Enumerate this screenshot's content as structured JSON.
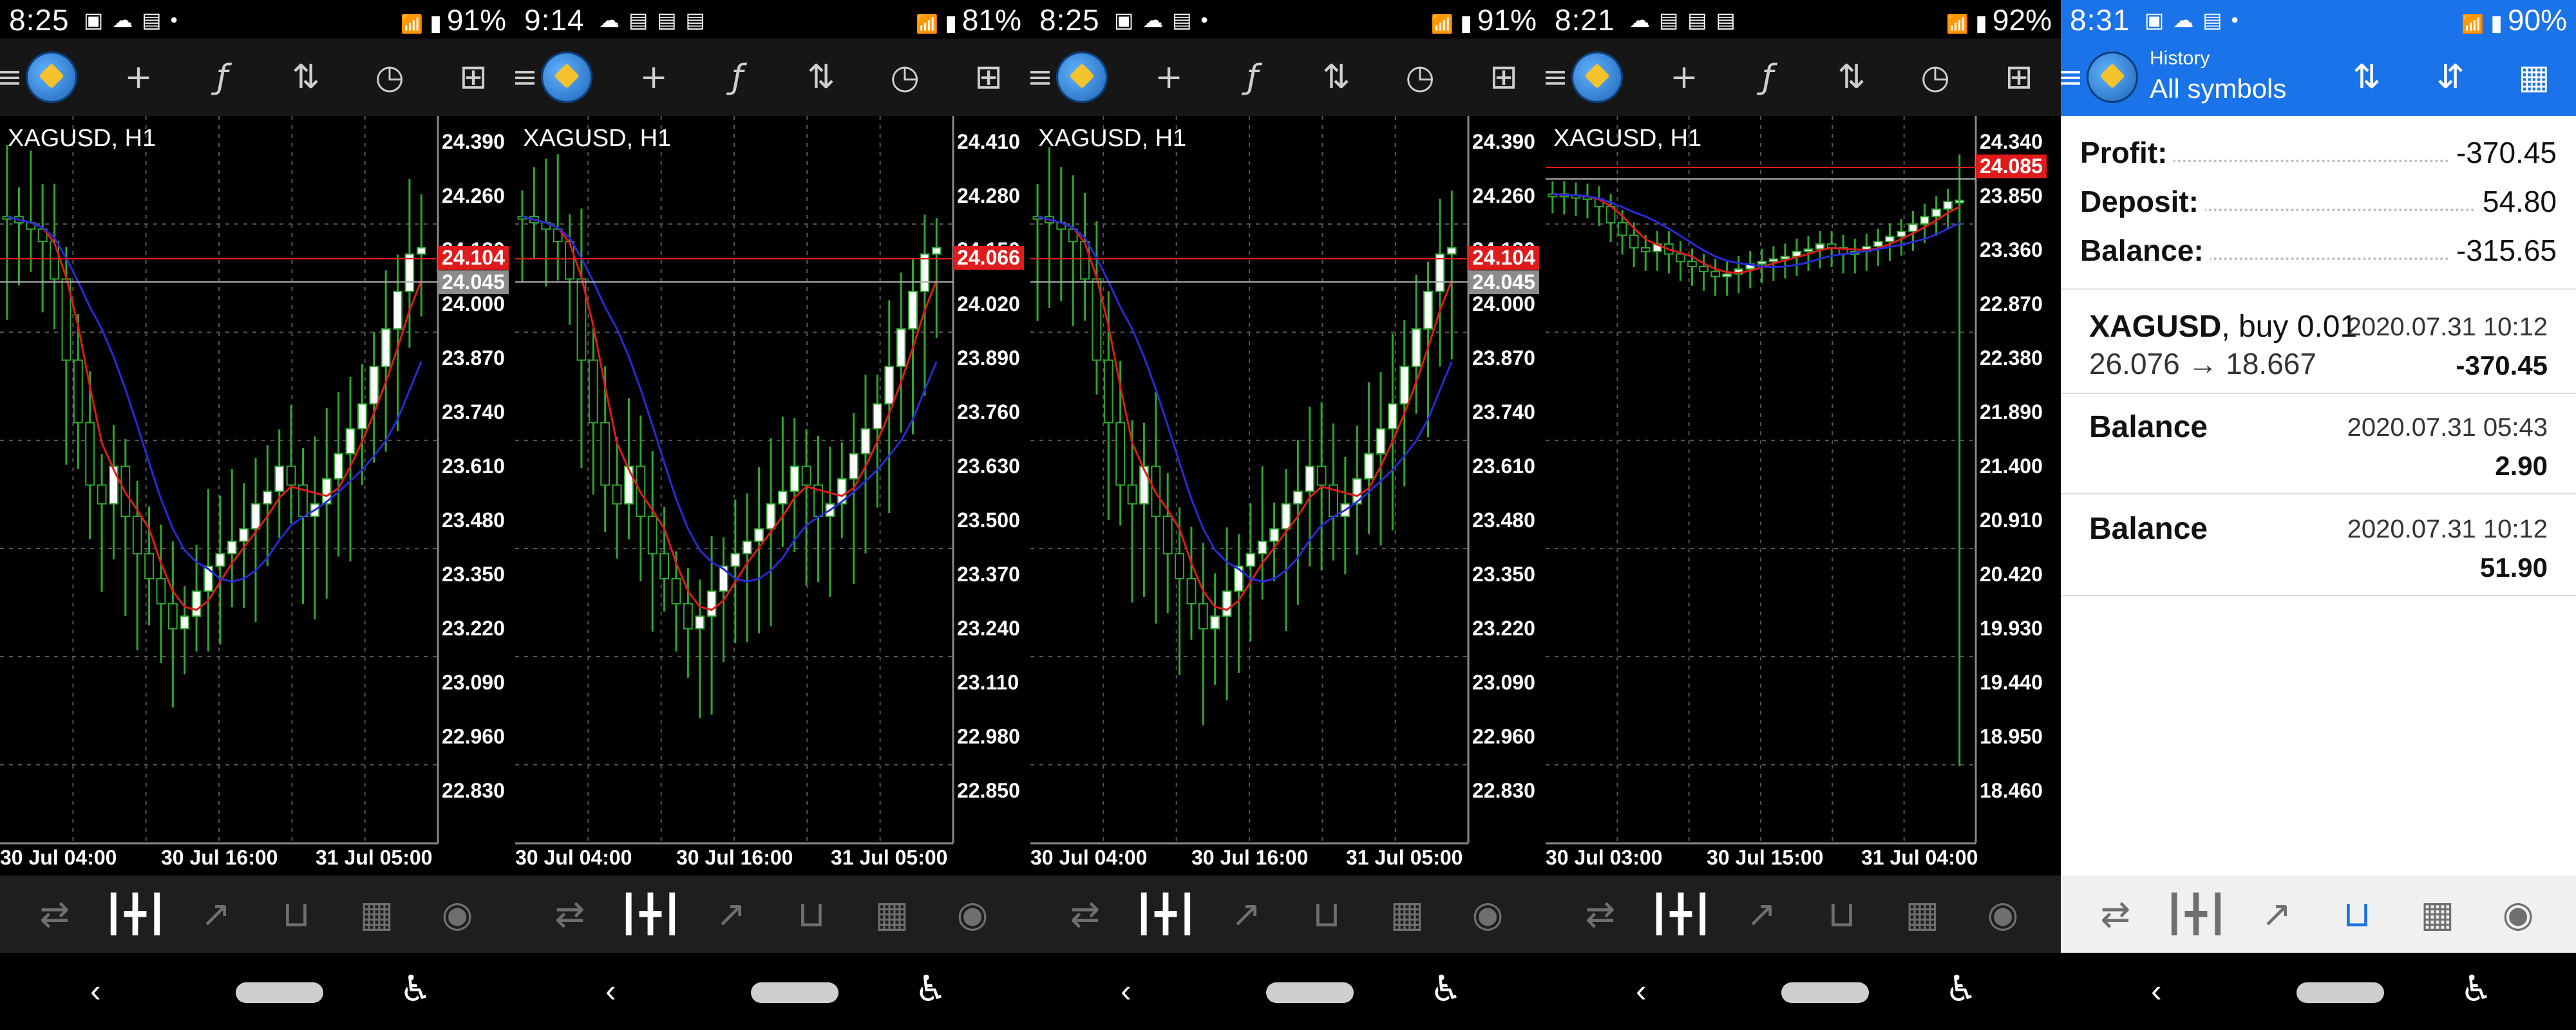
{
  "panels": [
    {
      "status": {
        "time": "8:25",
        "battery": "91%",
        "signal": "4G"
      },
      "chart": {
        "title": "XAGUSD, H1",
        "price_labels": [
          "24.390",
          "24.260",
          "24.130",
          "24.000",
          "23.870",
          "23.740",
          "23.610",
          "23.480",
          "23.350",
          "23.220",
          "23.090",
          "22.960",
          "22.830"
        ],
        "bid": "24.104",
        "ask": "24.045",
        "date_labels": [
          "30 Jul 04:00",
          "30 Jul 16:00",
          "31 Jul 05:00"
        ]
      }
    },
    {
      "status": {
        "time": "9:14",
        "battery": "81%",
        "signal": "4G"
      },
      "chart": {
        "title": "XAGUSD, H1",
        "price_labels": [
          "24.410",
          "24.280",
          "24.150",
          "24.020",
          "23.890",
          "23.760",
          "23.630",
          "23.500",
          "23.370",
          "23.240",
          "23.110",
          "22.980",
          "22.850"
        ],
        "bid": "24.066",
        "ask": "",
        "date_labels": [
          "30 Jul 04:00",
          "30 Jul 16:00",
          "31 Jul 05:00"
        ]
      }
    },
    {
      "status": {
        "time": "8:25",
        "battery": "91%",
        "signal": "4G"
      },
      "chart": {
        "title": "XAGUSD, H1",
        "price_labels": [
          "24.390",
          "24.260",
          "24.130",
          "24.000",
          "23.870",
          "23.740",
          "23.610",
          "23.480",
          "23.350",
          "23.220",
          "23.090",
          "22.960",
          "22.830"
        ],
        "bid": "24.104",
        "ask": "24.045",
        "date_labels": [
          "30 Jul 04:00",
          "30 Jul 16:00",
          "31 Jul 05:00"
        ]
      }
    },
    {
      "status": {
        "time": "8:21",
        "battery": "92%",
        "signal": "4G"
      },
      "chart": {
        "title": "XAGUSD, H1",
        "price_labels": [
          "24.340",
          "23.850",
          "23.360",
          "22.870",
          "22.380",
          "21.890",
          "21.400",
          "20.910",
          "20.420",
          "19.930",
          "19.440",
          "18.950",
          "18.460"
        ],
        "bid": "24.085",
        "ask": "",
        "date_labels": [
          "30 Jul 03:00",
          "30 Jul 15:00",
          "31 Jul 04:00"
        ]
      }
    }
  ],
  "history": {
    "status": {
      "time": "8:31",
      "battery": "90%",
      "signal": "4G"
    },
    "title_small": "History",
    "title_big": "All symbols",
    "summary": [
      {
        "label": "Profit:",
        "value": "-370.45"
      },
      {
        "label": "Deposit:",
        "value": "54.80"
      },
      {
        "label": "Balance:",
        "value": "-315.65"
      }
    ],
    "deal": {
      "symbol": "XAGUSD",
      "type": ", buy 0.01",
      "prices": "26.076 → 18.667",
      "time": "2020.07.31 10:12",
      "amount": "-370.45"
    },
    "balances": [
      {
        "label": "Balance",
        "time": "2020.07.31 05:43",
        "amount": "2.90"
      },
      {
        "label": "Balance",
        "time": "2020.07.31 10:12",
        "amount": "51.90"
      }
    ]
  },
  "colors": {
    "bull": "#ffffff",
    "bear": "#000000",
    "wick": "#2fa82f",
    "ma_fast": "#e01b1b",
    "ma_slow": "#2a2ad8",
    "grid": "#555555",
    "bid_bg": "#e01b1b",
    "ask_bg": "#8c8c8c",
    "accent": "#1a73e8"
  },
  "icons": {
    "toolbar_chart": [
      "menu-icon",
      "app-logo-icon",
      "crosshair-icon",
      "indicators-icon",
      "trade-icon",
      "timeframe-icon",
      "objects-icon"
    ],
    "toolbar_history": [
      "menu-icon",
      "app-logo-icon",
      "trade-icon",
      "sort-icon",
      "calendar-icon"
    ],
    "bottom_nav": [
      "quotes-icon",
      "chart-icon",
      "trade-icon",
      "history-icon",
      "news-icon",
      "chat-icon"
    ]
  }
}
